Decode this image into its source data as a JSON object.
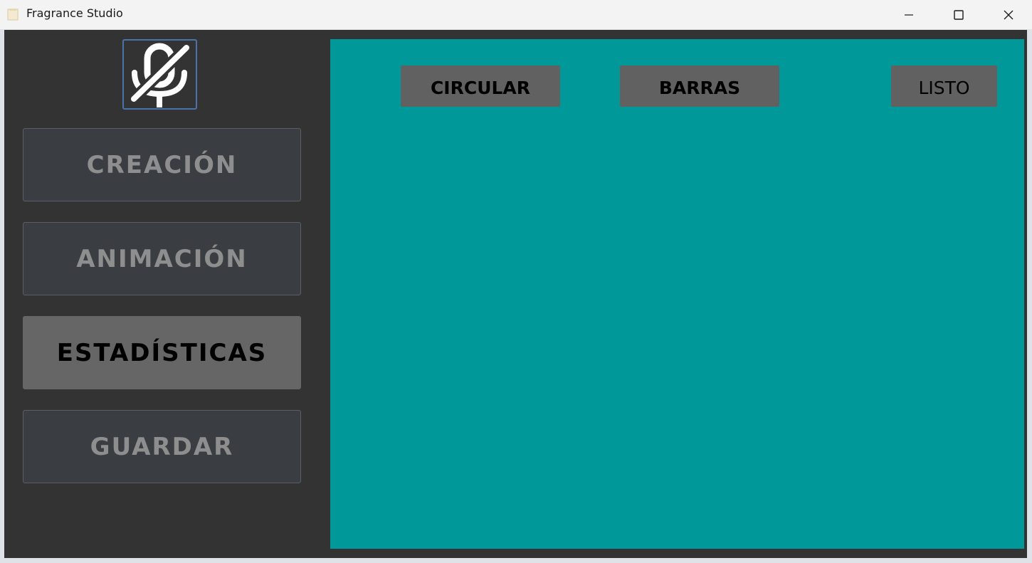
{
  "window": {
    "title": "Fragrance Studio",
    "app_icon": "app-icon",
    "controls": {
      "minimize_icon": "minimize-icon",
      "maximize_icon": "maximize-icon",
      "close_icon": "close-icon"
    }
  },
  "sidebar": {
    "logo_icon": "microphone-off-icon",
    "items": [
      {
        "label": "CREACIÓN",
        "active": false
      },
      {
        "label": "ANIMACIÓN",
        "active": false
      },
      {
        "label": "ESTADÍSTICAS",
        "active": true
      },
      {
        "label": "GUARDAR",
        "active": false
      }
    ]
  },
  "main": {
    "buttons": {
      "circular": "CIRCULAR",
      "barras": "BARRAS",
      "listo": "LISTO"
    }
  },
  "colors": {
    "sidebar_bg": "#333333",
    "panel_bg": "#009898",
    "nav_button_bg": "#3a3d41",
    "nav_active_bg": "#666666",
    "chart_button_bg": "#616161",
    "logo_border": "#4a74a8"
  }
}
